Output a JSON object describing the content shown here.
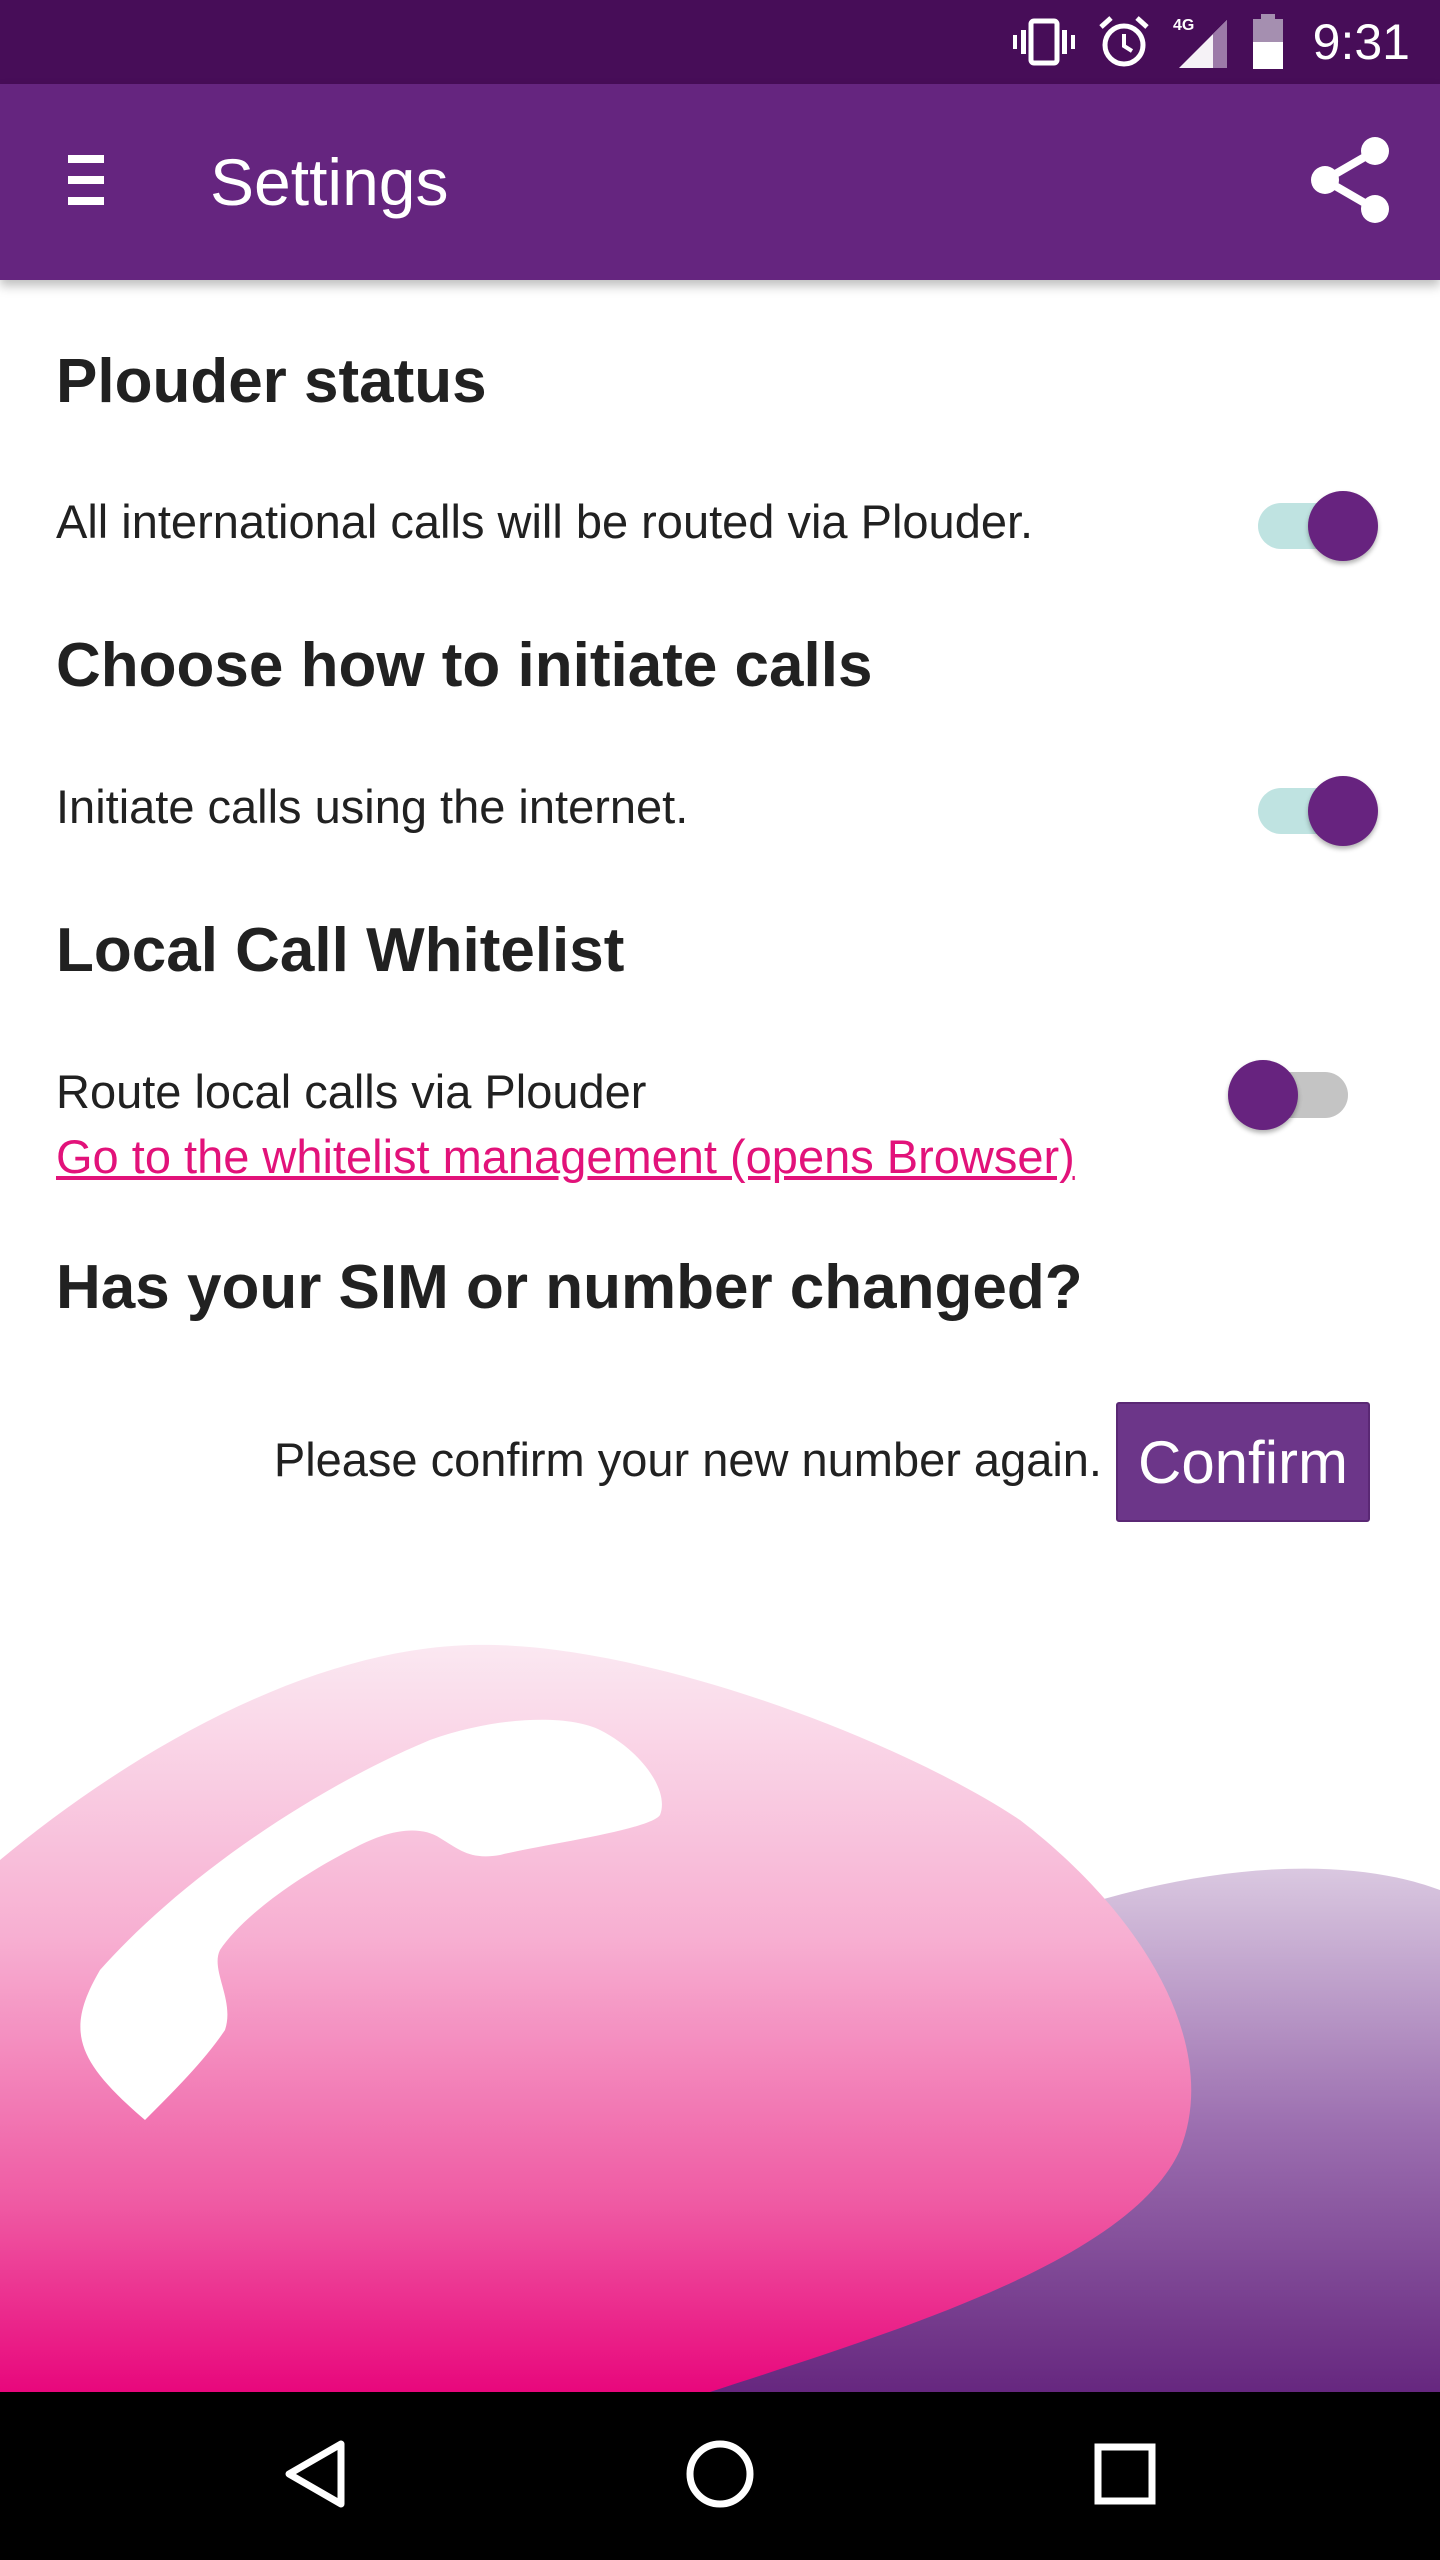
{
  "status_bar": {
    "time": "9:31",
    "network": "4G",
    "icons": [
      "vibrate-icon",
      "alarm-icon",
      "signal-icon",
      "battery-icon"
    ]
  },
  "app_bar": {
    "title": "Settings",
    "menu_icon": "hamburger-menu-icon",
    "share_icon": "share-icon"
  },
  "sections": {
    "plouder_status": {
      "title": "Plouder status",
      "description": "All international calls will be routed via Plouder.",
      "toggle_on": true
    },
    "initiate_calls": {
      "title": "Choose how to initiate calls",
      "description": "Initiate calls using the internet.",
      "toggle_on": true
    },
    "whitelist": {
      "title": "Local Call Whitelist",
      "description": "Route local calls via Plouder",
      "link": "Go to the whitelist management (opens Browser)",
      "toggle_on": false
    },
    "sim_changed": {
      "title": "Has your SIM or number changed?",
      "description": "Please confirm your new number again.",
      "button": "Confirm"
    }
  },
  "nav_bar": {
    "icons": [
      "back-icon",
      "home-icon",
      "recents-icon"
    ]
  },
  "colors": {
    "status_bar": "#470d58",
    "app_bar": "#65257f",
    "accent": "#67237f",
    "link": "#e2127a",
    "toggle_track_on": "#bfe3e1",
    "toggle_track_off": "#c4c4c4",
    "button": "#6c3689"
  }
}
